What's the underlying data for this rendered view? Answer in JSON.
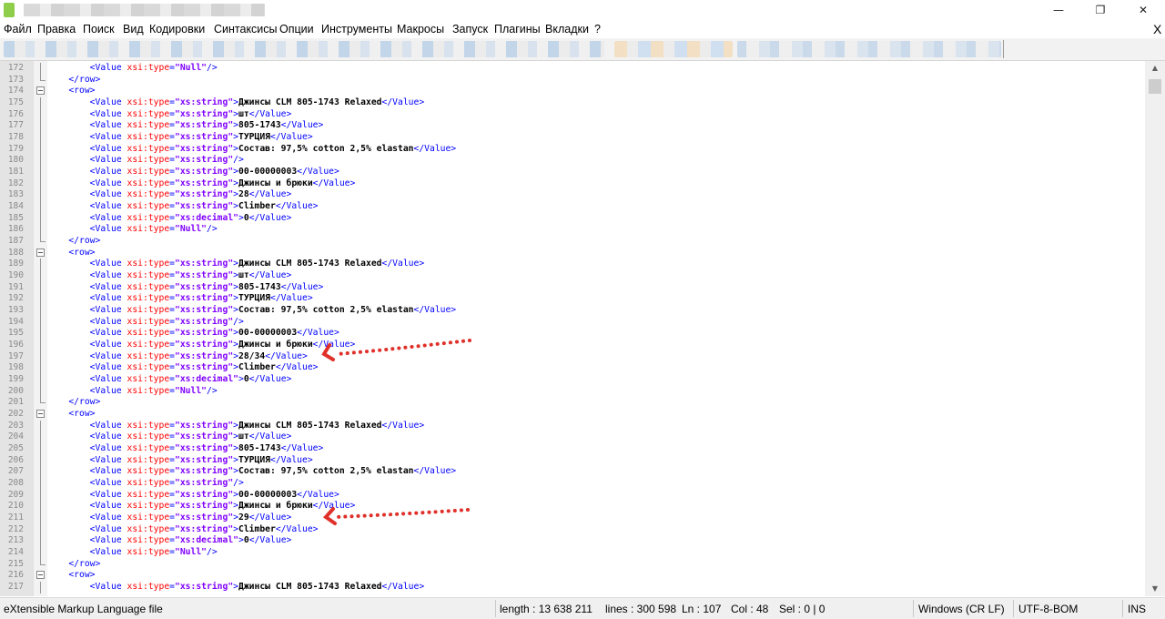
{
  "window": {
    "minimize": "—",
    "maximize": "❐",
    "close": "✕"
  },
  "menu": [
    "Файл",
    "Правка",
    "Поиск",
    "Вид",
    "Кодировки",
    "Синтаксисы",
    "Опции",
    "Инструменты",
    "Макросы",
    "Запуск",
    "Плагины",
    "Вкладки",
    "?"
  ],
  "menu_close": "X",
  "lines": [
    {
      "n": "172",
      "k": "v",
      "t": "Null"
    },
    {
      "n": "173",
      "k": "close"
    },
    {
      "n": "174",
      "k": "open"
    },
    {
      "n": "175",
      "k": "s",
      "v": "Джинсы CLM 805-1743 Relaxed"
    },
    {
      "n": "176",
      "k": "s",
      "v": "шт"
    },
    {
      "n": "177",
      "k": "s",
      "v": "805-1743"
    },
    {
      "n": "178",
      "k": "s",
      "v": "ТУРЦИЯ"
    },
    {
      "n": "179",
      "k": "s",
      "v": "Состав: 97,5% cotton 2,5% elastan"
    },
    {
      "n": "180",
      "k": "e",
      "t": "xs:string"
    },
    {
      "n": "181",
      "k": "s",
      "v": "00-00000003"
    },
    {
      "n": "182",
      "k": "s",
      "v": "Джинсы и брюки"
    },
    {
      "n": "183",
      "k": "s",
      "v": "28"
    },
    {
      "n": "184",
      "k": "s",
      "v": "Climber"
    },
    {
      "n": "185",
      "k": "d",
      "v": "0"
    },
    {
      "n": "186",
      "k": "v",
      "t": "Null"
    },
    {
      "n": "187",
      "k": "close"
    },
    {
      "n": "188",
      "k": "open"
    },
    {
      "n": "189",
      "k": "s",
      "v": "Джинсы CLM 805-1743 Relaxed"
    },
    {
      "n": "190",
      "k": "s",
      "v": "шт"
    },
    {
      "n": "191",
      "k": "s",
      "v": "805-1743"
    },
    {
      "n": "192",
      "k": "s",
      "v": "ТУРЦИЯ"
    },
    {
      "n": "193",
      "k": "s",
      "v": "Состав: 97,5% cotton 2,5% elastan"
    },
    {
      "n": "194",
      "k": "e",
      "t": "xs:string"
    },
    {
      "n": "195",
      "k": "s",
      "v": "00-00000003"
    },
    {
      "n": "196",
      "k": "s",
      "v": "Джинсы и брюки"
    },
    {
      "n": "197",
      "k": "s",
      "v": "28/34"
    },
    {
      "n": "198",
      "k": "s",
      "v": "Climber"
    },
    {
      "n": "199",
      "k": "d",
      "v": "0"
    },
    {
      "n": "200",
      "k": "v",
      "t": "Null"
    },
    {
      "n": "201",
      "k": "close"
    },
    {
      "n": "202",
      "k": "open"
    },
    {
      "n": "203",
      "k": "s",
      "v": "Джинсы CLM 805-1743 Relaxed"
    },
    {
      "n": "204",
      "k": "s",
      "v": "шт"
    },
    {
      "n": "205",
      "k": "s",
      "v": "805-1743"
    },
    {
      "n": "206",
      "k": "s",
      "v": "ТУРЦИЯ"
    },
    {
      "n": "207",
      "k": "s",
      "v": "Состав: 97,5% cotton 2,5% elastan"
    },
    {
      "n": "208",
      "k": "e",
      "t": "xs:string"
    },
    {
      "n": "209",
      "k": "s",
      "v": "00-00000003"
    },
    {
      "n": "210",
      "k": "s",
      "v": "Джинсы и брюки"
    },
    {
      "n": "211",
      "k": "s",
      "v": "29"
    },
    {
      "n": "212",
      "k": "s",
      "v": "Climber"
    },
    {
      "n": "213",
      "k": "d",
      "v": "0"
    },
    {
      "n": "214",
      "k": "v",
      "t": "Null"
    },
    {
      "n": "215",
      "k": "close"
    },
    {
      "n": "216",
      "k": "open"
    },
    {
      "n": "217",
      "k": "s",
      "v": "Джинсы CLM 805-1743 Relaxed"
    }
  ],
  "status": {
    "file_type": "eXtensible Markup Language file",
    "length": "length : 13 638 211",
    "lines": "lines : 300 598",
    "ln": "Ln : 107",
    "col": "Col : 48",
    "sel": "Sel : 0 | 0",
    "eol": "Windows (CR LF)",
    "encoding": "UTF-8-BOM",
    "mode": "INS"
  },
  "colors": {
    "tag": "#0000ff",
    "attr": "#ff0000",
    "attr_value": "#8000ff",
    "arrow": "#e0302a"
  }
}
